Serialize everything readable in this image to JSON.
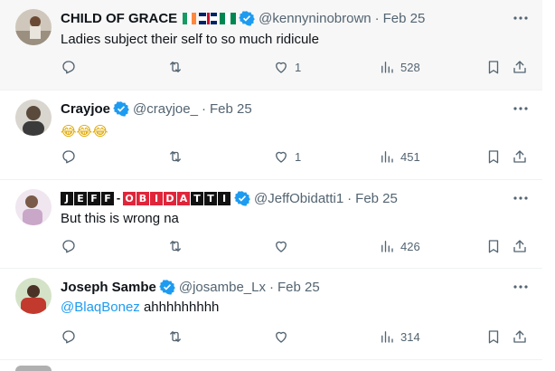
{
  "tweets": [
    {
      "name": "CHILD OF GRACE",
      "handle": "@kennyninobrown",
      "date": "Feb 25",
      "text": "Ladies subject their self to so much ridicule",
      "likes": "1",
      "views": "528",
      "retweets": "",
      "replies": "",
      "avatar_color": "#9b8f80"
    },
    {
      "name": "Crayjoe",
      "handle": "@crayjoe_",
      "date": "Feb 25",
      "text_emoji": "😂😂😂",
      "likes": "1",
      "views": "451",
      "avatar_color": "#5a4a3c"
    },
    {
      "name_letters_dark": [
        "J",
        "E",
        "F",
        "F"
      ],
      "name_hyphen": "-",
      "name_letters_red": [
        "O",
        "B",
        "I",
        "D",
        "A"
      ],
      "name_letters_dark2": [
        "T",
        "T",
        "I"
      ],
      "handle": "@JeffObidatti1",
      "date": "Feb 25",
      "text": "But this is wrong na",
      "likes": "",
      "views": "426",
      "avatar_color": "#c9a7c9"
    },
    {
      "name": "Joseph Sambe",
      "handle": "@josambe_Lx",
      "date": "Feb 25",
      "mention": "@BlaqBonez",
      "text": "ahhhhhhhhh",
      "likes": "",
      "views": "314",
      "avatar_color": "#c23a2e"
    }
  ],
  "colors": {
    "verified": "#1d9bf0",
    "muted": "#536471",
    "mention": "#1d9bf0"
  },
  "icons": [
    "reply-icon",
    "retweet-icon",
    "like-icon",
    "views-icon",
    "bookmark-icon",
    "share-icon",
    "more-icon",
    "verified-badge-icon"
  ]
}
